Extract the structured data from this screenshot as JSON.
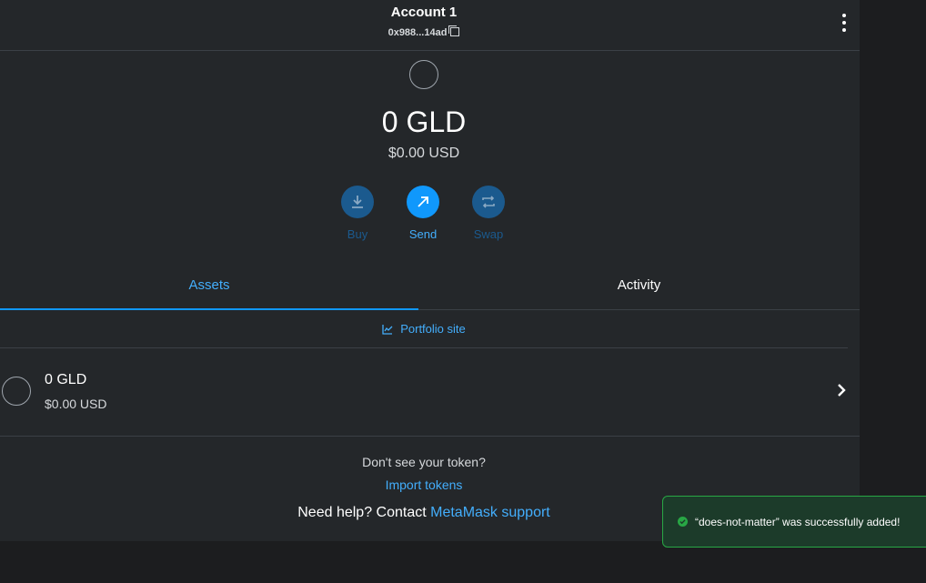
{
  "header": {
    "account_name": "Account 1",
    "account_address": "0x988...14ad"
  },
  "balance": {
    "amount": "0 GLD",
    "fiat": "$0.00 USD"
  },
  "actions": {
    "buy": "Buy",
    "send": "Send",
    "swap": "Swap"
  },
  "tabs": {
    "assets": "Assets",
    "activity": "Activity"
  },
  "portfolio_link": "Portfolio site",
  "assets": [
    {
      "name": "0 GLD",
      "fiat": "$0.00 USD"
    }
  ],
  "footer": {
    "dont_see": "Don't see your token?",
    "import_tokens": "Import tokens",
    "help_prefix": "Need help? Contact ",
    "help_link": "MetaMask support"
  },
  "toast": {
    "message": "“does-not-matter” was successfully added!"
  },
  "colors": {
    "accent": "#1098fc",
    "link": "#43aefc",
    "success": "#28a745",
    "panel": "#24272a"
  }
}
